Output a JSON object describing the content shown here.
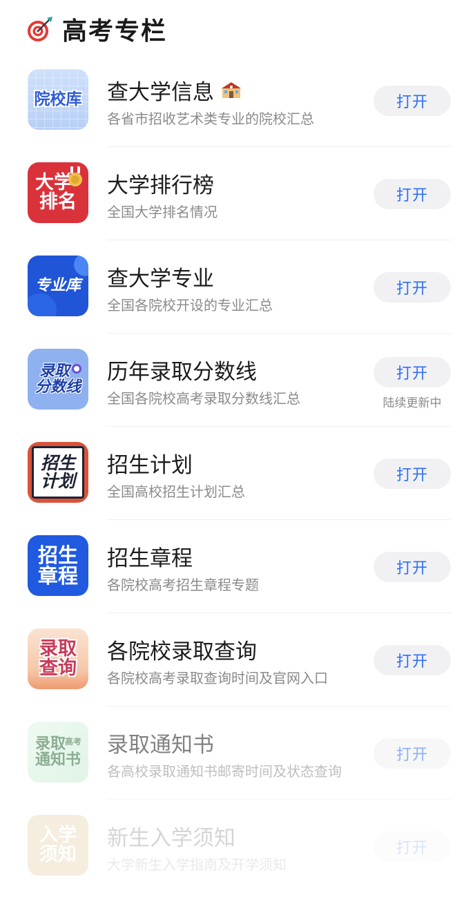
{
  "header": {
    "title": "高考专栏",
    "icon": "target-dart-icon"
  },
  "button_label": "打开",
  "items": [
    {
      "title": "查大学信息",
      "title_icon": "school-building-icon",
      "subtitle": "各省市招收艺术类专业的院校汇总",
      "icon_text": [
        "院校库"
      ],
      "note": ""
    },
    {
      "title": "大学排行榜",
      "subtitle": "全国大学排名情况",
      "icon_text": [
        "大学",
        "排名"
      ],
      "note": ""
    },
    {
      "title": "查大学专业",
      "subtitle": "全国各院校开设的专业汇总",
      "icon_text": [
        "专业库"
      ],
      "note": ""
    },
    {
      "title": "历年录取分数线",
      "subtitle": "全国各院校高考录取分数线汇总",
      "icon_text": [
        "录取",
        "分数线"
      ],
      "note": "陆续更新中"
    },
    {
      "title": "招生计划",
      "subtitle": "全国高校招生计划汇总",
      "icon_text": [
        "招生",
        "计划"
      ],
      "note": ""
    },
    {
      "title": "招生章程",
      "subtitle": "各院校高考招生章程专题",
      "icon_text": [
        "招生",
        "章程"
      ],
      "note": ""
    },
    {
      "title": "各院校录取查询",
      "subtitle": "各院校高考录取查询时间及官网入口",
      "icon_text": [
        "录取",
        "查询"
      ],
      "note": ""
    },
    {
      "title": "录取通知书",
      "subtitle": "各高校录取通知书邮寄时间及状态查询",
      "icon_text": [
        "录取",
        "通知书",
        "高考"
      ],
      "note": ""
    },
    {
      "title": "新生入学须知",
      "subtitle": "大学新生入学指南及开学须知",
      "icon_text": [
        "入学",
        "须知"
      ],
      "note": ""
    }
  ],
  "colors": {
    "accent": "#2f6ff2",
    "button_bg": "#f1f1f3",
    "subtitle": "#8a8a8a"
  }
}
